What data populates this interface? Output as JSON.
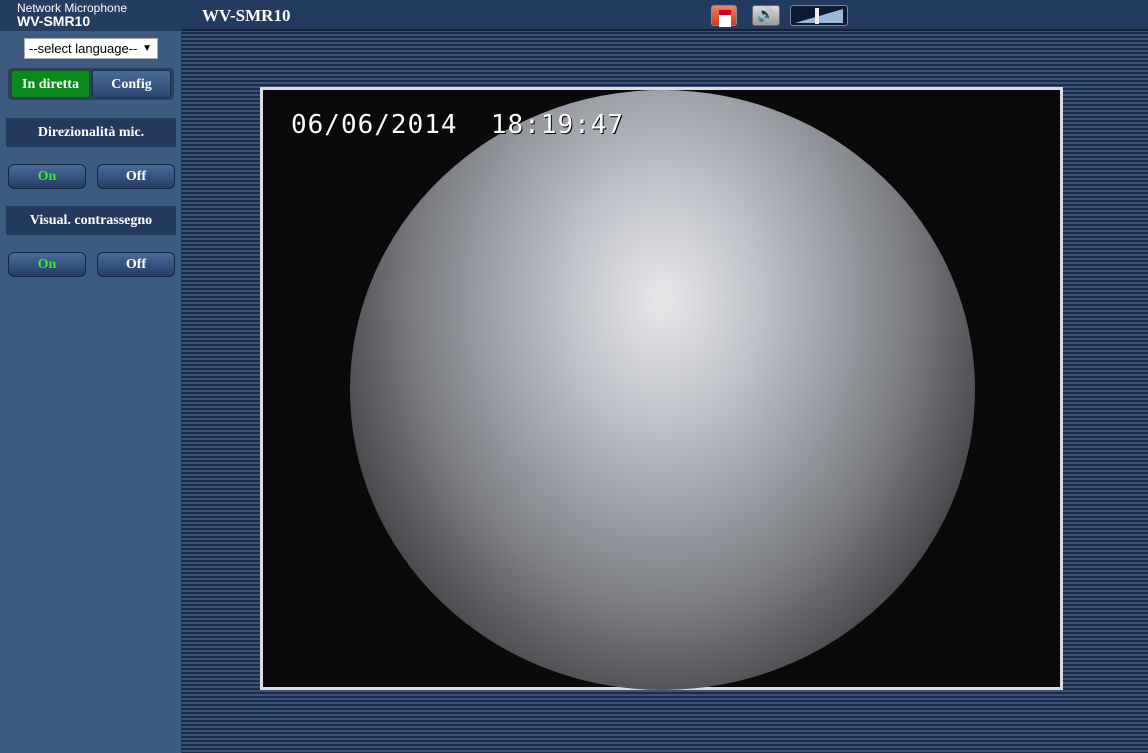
{
  "brand": {
    "subtitle": "Network Microphone",
    "model": "WV-SMR10"
  },
  "language": {
    "selected": "--select language--"
  },
  "modes": {
    "live": "In diretta",
    "config": "Config"
  },
  "sections": [
    {
      "title": "Direzionalità mic.",
      "on": "On",
      "off": "Off"
    },
    {
      "title": "Visual. contrassegno",
      "on": "On",
      "off": "Off"
    }
  ],
  "header": {
    "title": "WV-SMR10",
    "icons": [
      "record-icon",
      "speaker-icon",
      "volume-level-icon"
    ]
  },
  "video": {
    "date": "06/06/2014",
    "time": "18:19:47"
  },
  "colors": {
    "live_active": "#0a8a1a",
    "on_text": "#33ee33",
    "sidebar": "#3d5a80"
  }
}
